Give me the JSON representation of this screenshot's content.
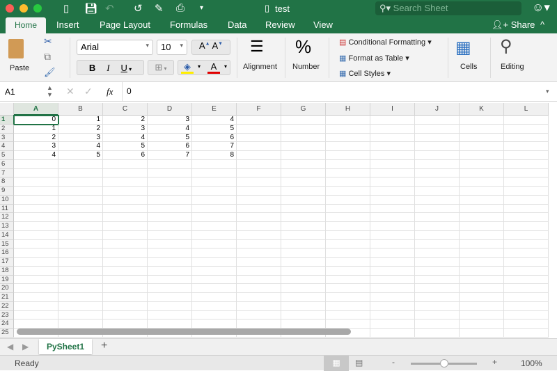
{
  "window": {
    "title": "test",
    "search_placeholder": "Search Sheet"
  },
  "tabs": [
    "Home",
    "Insert",
    "Page Layout",
    "Formulas",
    "Data",
    "Review",
    "View"
  ],
  "share_label": "Share",
  "ribbon": {
    "paste": "Paste",
    "font": "Arial",
    "size": "10",
    "bold": "B",
    "italic": "I",
    "underline": "U",
    "alignment": "Alignment",
    "number": "Number",
    "conditional": "Conditional Formatting",
    "format_table": "Format as Table",
    "cell_styles": "Cell Styles",
    "cells": "Cells",
    "editing": "Editing"
  },
  "formula_bar": {
    "name_box": "A1",
    "fx": "fx",
    "value": "0"
  },
  "columns": [
    "A",
    "B",
    "C",
    "D",
    "E",
    "F",
    "G",
    "H",
    "I",
    "J",
    "K",
    "L"
  ],
  "row_count": 25,
  "cells": [
    [
      0,
      1,
      2,
      3,
      4
    ],
    [
      1,
      2,
      3,
      4,
      5
    ],
    [
      2,
      3,
      4,
      5,
      6
    ],
    [
      3,
      4,
      5,
      6,
      7
    ],
    [
      4,
      5,
      6,
      7,
      8
    ]
  ],
  "sheet_tab": "PySheet1",
  "status": {
    "text": "Ready",
    "zoom": "100%",
    "zoom_fraction": 0.5
  },
  "colors": {
    "accent": "#217346"
  }
}
